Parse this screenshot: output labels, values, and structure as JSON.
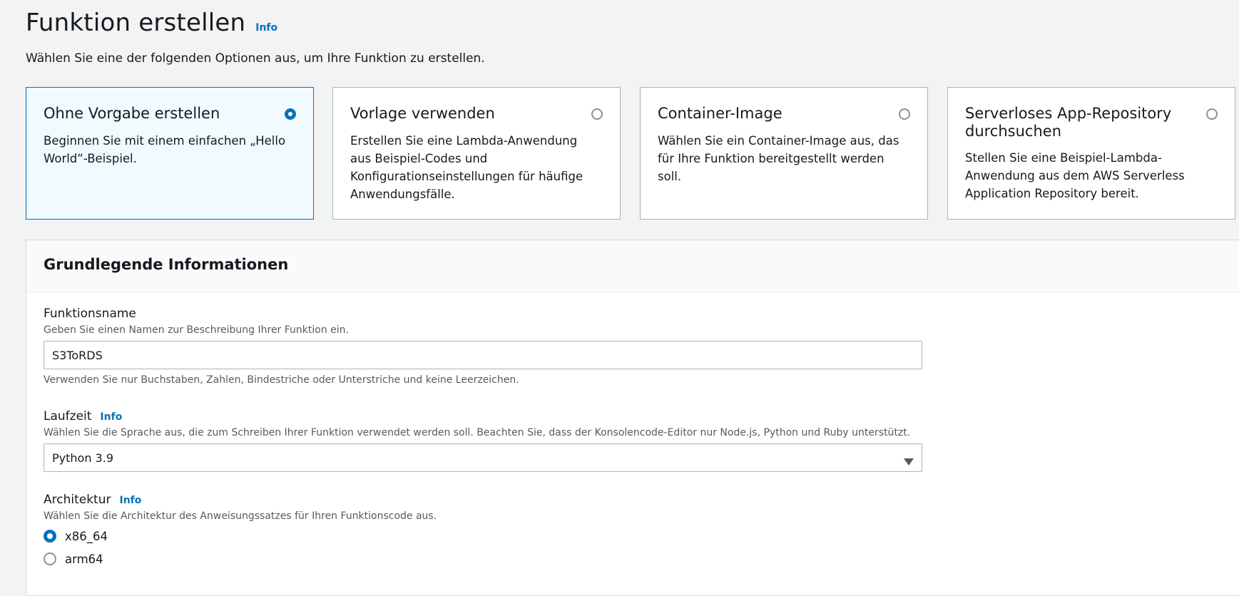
{
  "header": {
    "title": "Funktion erstellen",
    "info": "Info",
    "subtitle": "Wählen Sie eine der folgenden Optionen aus, um Ihre Funktion zu erstellen."
  },
  "options": [
    {
      "title": "Ohne Vorgabe erstellen",
      "description": "Beginnen Sie mit einem einfachen „Hello World“-Beispiel.",
      "selected": true
    },
    {
      "title": "Vorlage verwenden",
      "description": "Erstellen Sie eine Lambda-Anwendung aus Beispiel-Codes und Konfigurationseinstellungen für häufige Anwendungsfälle.",
      "selected": false
    },
    {
      "title": "Container-Image",
      "description": "Wählen Sie ein Container-Image aus, das für Ihre Funktion bereitgestellt werden soll.",
      "selected": false
    },
    {
      "title": "Serverloses App-Repository durchsuchen",
      "description": "Stellen Sie eine Beispiel-Lambda-Anwendung aus dem AWS Serverless Application Repository bereit.",
      "selected": false
    }
  ],
  "basic_info": {
    "heading": "Grundlegende Informationen",
    "function_name": {
      "label": "Funktionsname",
      "description": "Geben Sie einen Namen zur Beschreibung Ihrer Funktion ein.",
      "value": "S3ToRDS",
      "constraint": "Verwenden Sie nur Buchstaben, Zahlen, Bindestriche oder Unterstriche und keine Leerzeichen."
    },
    "runtime": {
      "label": "Laufzeit",
      "info": "Info",
      "description": "Wählen Sie die Sprache aus, die zum Schreiben Ihrer Funktion verwendet werden soll. Beachten Sie, dass der Konsolencode-Editor nur Node.js, Python und Ruby unterstützt.",
      "value": "Python 3.9"
    },
    "architecture": {
      "label": "Architektur",
      "info": "Info",
      "description": "Wählen Sie die Architektur des Anweisungssatzes für Ihren Funktionscode aus.",
      "options": [
        {
          "label": "x86_64",
          "selected": true
        },
        {
          "label": "arm64",
          "selected": false
        }
      ]
    }
  }
}
